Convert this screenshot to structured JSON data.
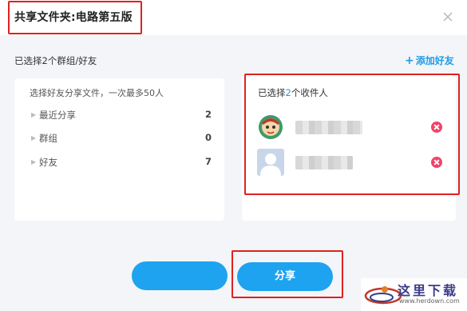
{
  "dialog": {
    "title": "共享文件夹:电路第五版"
  },
  "summary": {
    "selected_text": "已选择2个群组/好友",
    "add_friend_label": "添加好友"
  },
  "left_panel": {
    "hint": "选择好友分享文件，一次最多50人",
    "rows": [
      {
        "label": "最近分享",
        "count": "2"
      },
      {
        "label": "群组",
        "count": "0"
      },
      {
        "label": "好友",
        "count": "7"
      }
    ]
  },
  "right_panel": {
    "title_prefix": "已选择",
    "title_count": "2",
    "title_suffix": "个收件人"
  },
  "buttons": {
    "share_label": "分享"
  },
  "watermark": {
    "text": "这里下载",
    "url": "www.herdown.com"
  },
  "colors": {
    "accent": "#1da3f0",
    "remove": "#f0436a",
    "highlight": "#e02020"
  }
}
